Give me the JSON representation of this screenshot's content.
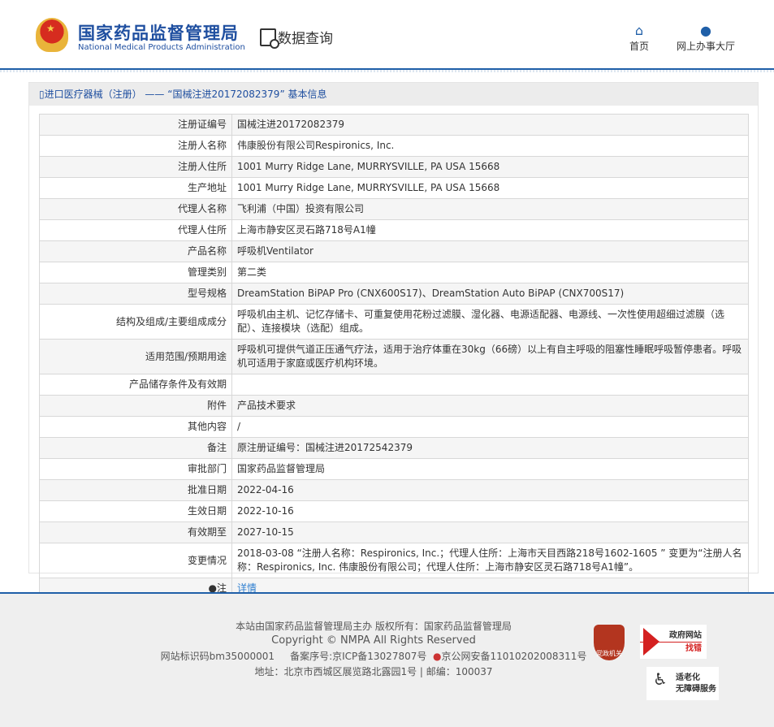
{
  "header": {
    "logo_cn": "国家药品监督管理局",
    "logo_en": "National Medical Products Administration",
    "section": "数据查询",
    "nav": [
      {
        "label": "首页",
        "icon": "home-icon"
      },
      {
        "label": "网上办事大厅",
        "icon": "user-icon"
      }
    ]
  },
  "panel": {
    "title": "进口医疗器械（注册） —— “国械注进20172082379” 基本信息"
  },
  "rows": [
    {
      "label": "注册证编号",
      "value": "国械注进20172082379"
    },
    {
      "label": "注册人名称",
      "value": "伟康股份有限公司Respironics, Inc."
    },
    {
      "label": "注册人住所",
      "value": "1001 Murry Ridge Lane, MURRYSVILLE, PA USA 15668"
    },
    {
      "label": "生产地址",
      "value": "1001 Murry Ridge Lane, MURRYSVILLE, PA USA 15668"
    },
    {
      "label": "代理人名称",
      "value": "飞利浦（中国）投资有限公司"
    },
    {
      "label": "代理人住所",
      "value": "上海市静安区灵石路718号A1幢"
    },
    {
      "label": "产品名称",
      "value": "呼吸机Ventilator"
    },
    {
      "label": "管理类别",
      "value": "第二类"
    },
    {
      "label": "型号规格",
      "value": "DreamStation BiPAP Pro (CNX600S17)、DreamStation Auto BiPAP (CNX700S17)"
    },
    {
      "label": "结构及组成/主要组成成分",
      "value": "呼吸机由主机、记忆存储卡、可重复使用花粉过滤膜、湿化器、电源适配器、电源线、一次性使用超细过滤膜（选配）、连接模块（选配）组成。"
    },
    {
      "label": "适用范围/预期用途",
      "value": "呼吸机可提供气道正压通气疗法，适用于治疗体重在30kg（66磅）以上有自主呼吸的阻塞性睡眠呼吸暂停患者。呼吸机可适用于家庭或医疗机构环境。"
    },
    {
      "label": "产品储存条件及有效期",
      "value": ""
    },
    {
      "label": "附件",
      "value": "产品技术要求"
    },
    {
      "label": "其他内容",
      "value": "/"
    },
    {
      "label": "备注",
      "value": "原注册证编号：国械注进20172542379"
    },
    {
      "label": "审批部门",
      "value": "国家药品监督管理局"
    },
    {
      "label": "批准日期",
      "value": "2022-04-16"
    },
    {
      "label": "生效日期",
      "value": "2022-10-16"
    },
    {
      "label": "有效期至",
      "value": "2027-10-15"
    },
    {
      "label": "变更情况",
      "value": "2018-03-08 “注册人名称：Respironics, Inc.；代理人住所：上海市天目西路218号1602-1605 ” 变更为“注册人名称：Respironics, Inc. 伟康股份有限公司；代理人住所：上海市静安区灵石路718号A1幢”。"
    }
  ],
  "note": {
    "label": "注",
    "link": "详情"
  },
  "footer": {
    "line1": "本站由国家药品监督管理局主办 版权所有：国家药品监督管理局",
    "line2": "Copyright © NMPA All Rights Reserved",
    "site_id": "网站标识码bm35000001",
    "icp": "备案序号:京ICP备13027807号",
    "police": "京公网安备11010202008311号",
    "address": "地址：北京市西城区展览路北露园1号 | 邮编：100037",
    "badge_party": "党政机关",
    "badge_error": [
      "政府网站",
      "找错"
    ],
    "badge_access": [
      "适老化",
      "无障碍服务"
    ]
  },
  "colors": {
    "brand": "#1f4fa0",
    "link": "#2f7fd0"
  }
}
